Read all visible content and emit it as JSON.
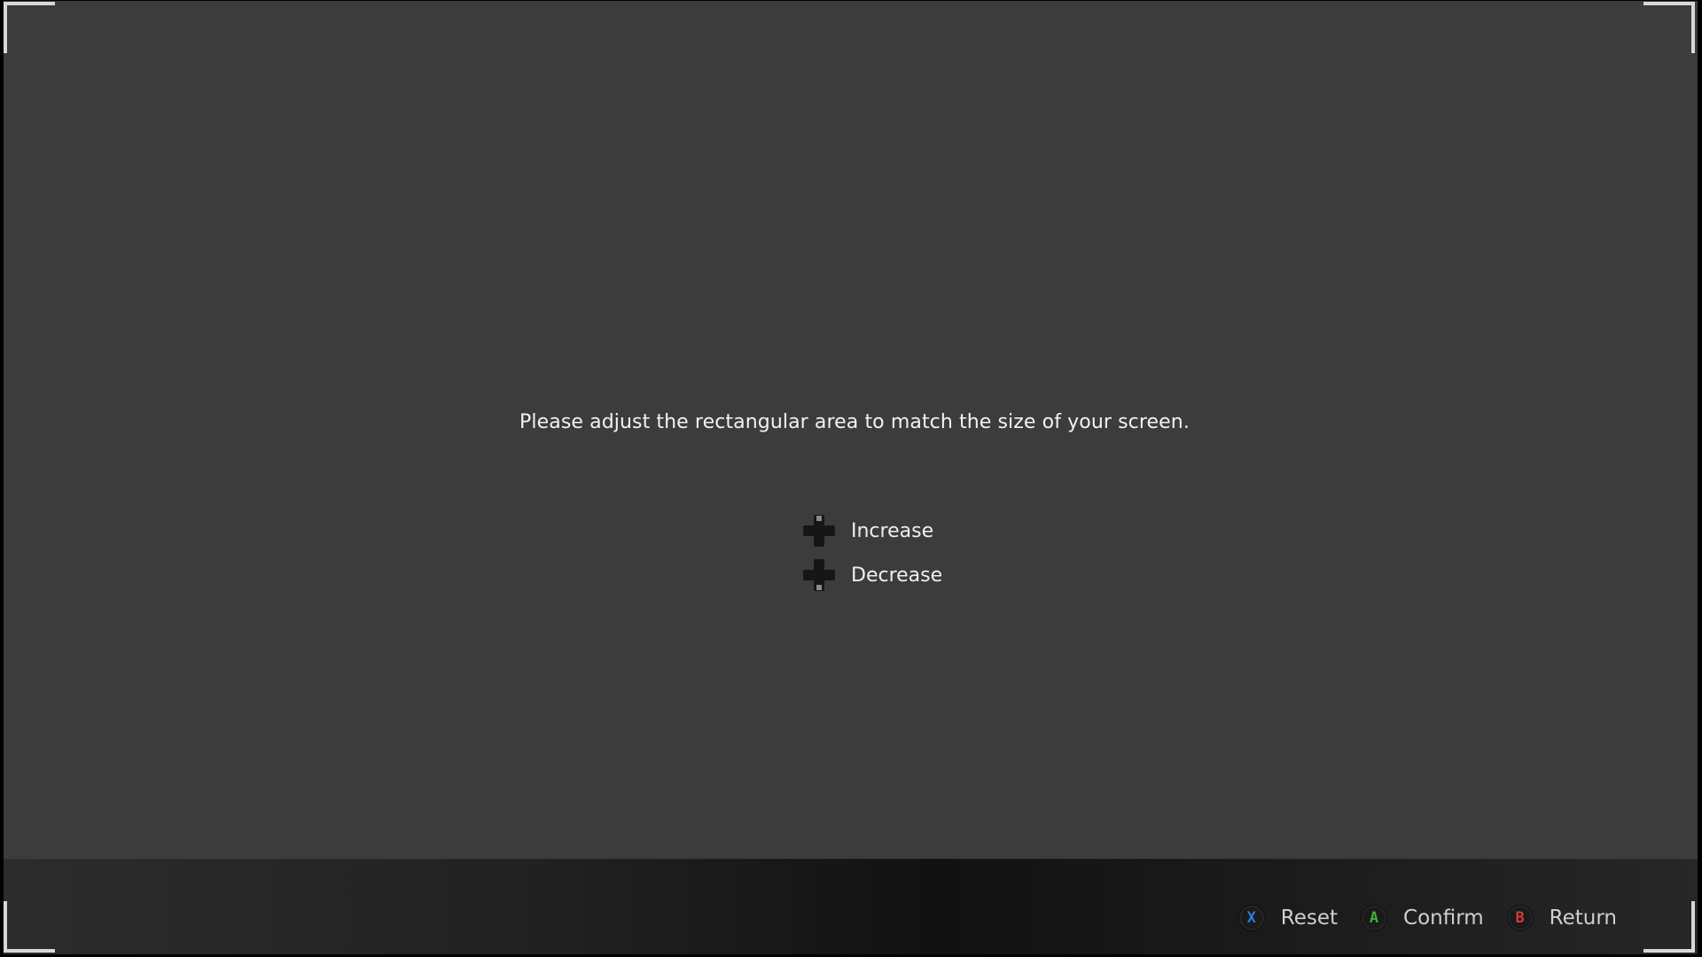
{
  "instruction": "Please adjust the rectangular area to match the size of your screen.",
  "controls": [
    {
      "label": "Increase",
      "icon": "dpad-up-icon"
    },
    {
      "label": "Decrease",
      "icon": "dpad-down-icon"
    }
  ],
  "button_hints": [
    {
      "glyph": "X",
      "label": "Reset",
      "color": "#2d7bd6"
    },
    {
      "glyph": "A",
      "label": "Confirm",
      "color": "#3fae3f"
    },
    {
      "glyph": "B",
      "label": "Return",
      "color": "#d23a3a"
    }
  ],
  "colors": {
    "background": "#3c3c3c",
    "corner_marker": "#d8d8d8"
  }
}
